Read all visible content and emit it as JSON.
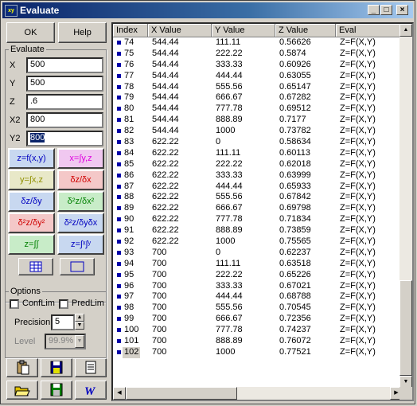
{
  "window": {
    "title": "Evaluate",
    "icon_label": "xy"
  },
  "buttons": {
    "ok": "OK",
    "help": "Help"
  },
  "evaluate": {
    "group_label": "Evaluate",
    "fields": [
      {
        "label": "X",
        "value": "500"
      },
      {
        "label": "Y",
        "value": "500"
      },
      {
        "label": "Z",
        "value": ".6"
      },
      {
        "label": "X2",
        "value": "800"
      },
      {
        "label": "Y2",
        "value": "800"
      }
    ],
    "functions": [
      {
        "label": "z=f(x,y)",
        "color": "#0000c0",
        "bg": "#c8d8f0"
      },
      {
        "label": "x=∫y,z",
        "color": "#e000e0",
        "bg": "#f0c8f0"
      },
      {
        "label": "y=∫x,z",
        "color": "#909000",
        "bg": "#e8e8c8"
      },
      {
        "label": "δz/δx",
        "color": "#d00000",
        "bg": "#f4c8c8"
      },
      {
        "label": "δz/δy",
        "color": "#0000c0",
        "bg": "#c8d8f0"
      },
      {
        "label": "δ²z/δx²",
        "color": "#008000",
        "bg": "#c8ecc8"
      },
      {
        "label": "δ²z/δy²",
        "color": "#d00000",
        "bg": "#f4c8c8"
      },
      {
        "label": "δ²z/δyδx",
        "color": "#0000c0",
        "bg": "#c8d8f0"
      },
      {
        "label": "z=∫∫",
        "color": "#008000",
        "bg": "#c8ecc8"
      },
      {
        "label": "z=∫ˣ∫ʸ",
        "color": "#0000c0",
        "bg": "#c8d8f0"
      }
    ]
  },
  "options": {
    "group_label": "Options",
    "conflim": "ConfLim",
    "predlim": "PredLim",
    "precision_label": "Precision",
    "precision_value": "5",
    "level_label": "Level",
    "level_value": "99.9%"
  },
  "table": {
    "columns": [
      "Index",
      "X Value",
      "Y Value",
      "Z Value",
      "Eval"
    ],
    "rows": [
      [
        "74",
        "544.44",
        "111.11",
        "0.56626",
        "Z=F(X,Y)"
      ],
      [
        "75",
        "544.44",
        "222.22",
        "0.5874",
        "Z=F(X,Y)"
      ],
      [
        "76",
        "544.44",
        "333.33",
        "0.60926",
        "Z=F(X,Y)"
      ],
      [
        "77",
        "544.44",
        "444.44",
        "0.63055",
        "Z=F(X,Y)"
      ],
      [
        "78",
        "544.44",
        "555.56",
        "0.65147",
        "Z=F(X,Y)"
      ],
      [
        "79",
        "544.44",
        "666.67",
        "0.67282",
        "Z=F(X,Y)"
      ],
      [
        "80",
        "544.44",
        "777.78",
        "0.69512",
        "Z=F(X,Y)"
      ],
      [
        "81",
        "544.44",
        "888.89",
        "0.7177",
        "Z=F(X,Y)"
      ],
      [
        "82",
        "544.44",
        "1000",
        "0.73782",
        "Z=F(X,Y)"
      ],
      [
        "83",
        "622.22",
        "0",
        "0.58634",
        "Z=F(X,Y)"
      ],
      [
        "84",
        "622.22",
        "111.11",
        "0.60113",
        "Z=F(X,Y)"
      ],
      [
        "85",
        "622.22",
        "222.22",
        "0.62018",
        "Z=F(X,Y)"
      ],
      [
        "86",
        "622.22",
        "333.33",
        "0.63999",
        "Z=F(X,Y)"
      ],
      [
        "87",
        "622.22",
        "444.44",
        "0.65933",
        "Z=F(X,Y)"
      ],
      [
        "88",
        "622.22",
        "555.56",
        "0.67842",
        "Z=F(X,Y)"
      ],
      [
        "89",
        "622.22",
        "666.67",
        "0.69798",
        "Z=F(X,Y)"
      ],
      [
        "90",
        "622.22",
        "777.78",
        "0.71834",
        "Z=F(X,Y)"
      ],
      [
        "91",
        "622.22",
        "888.89",
        "0.73859",
        "Z=F(X,Y)"
      ],
      [
        "92",
        "622.22",
        "1000",
        "0.75565",
        "Z=F(X,Y)"
      ],
      [
        "93",
        "700",
        "0",
        "0.62237",
        "Z=F(X,Y)"
      ],
      [
        "94",
        "700",
        "111.11",
        "0.63518",
        "Z=F(X,Y)"
      ],
      [
        "95",
        "700",
        "222.22",
        "0.65226",
        "Z=F(X,Y)"
      ],
      [
        "96",
        "700",
        "333.33",
        "0.67021",
        "Z=F(X,Y)"
      ],
      [
        "97",
        "700",
        "444.44",
        "0.68788",
        "Z=F(X,Y)"
      ],
      [
        "98",
        "700",
        "555.56",
        "0.70545",
        "Z=F(X,Y)"
      ],
      [
        "99",
        "700",
        "666.67",
        "0.72356",
        "Z=F(X,Y)"
      ],
      [
        "100",
        "700",
        "777.78",
        "0.74237",
        "Z=F(X,Y)"
      ],
      [
        "101",
        "700",
        "888.89",
        "0.76072",
        "Z=F(X,Y)"
      ],
      [
        "102",
        "700",
        "1000",
        "0.77521",
        "Z=F(X,Y)"
      ]
    ]
  }
}
